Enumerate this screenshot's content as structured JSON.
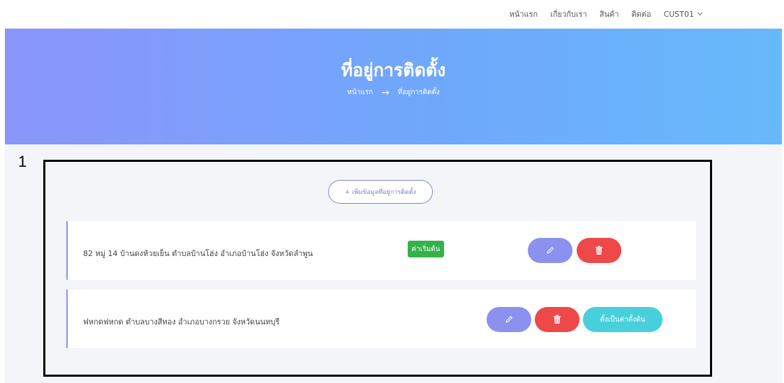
{
  "nav": {
    "items": [
      "หน้าแรก",
      "เกี่ยวกับเรา",
      "สินค้า",
      "ติดต่อ"
    ],
    "user": "CUST01"
  },
  "hero": {
    "title": "ที่อยู่การติดตั้ง",
    "breadcrumb": {
      "home": "หน้าแรก",
      "current": "ที่อยู่การติดตั้ง"
    }
  },
  "annotation": {
    "label": "1"
  },
  "main": {
    "add_button": "+ เพิ่มข้อมูลที่อยู่การติดตั้ง",
    "addresses": [
      {
        "text": "82 หมู่ 14 บ้านดงห้วยเย็น ตำบลบ้านโฮ่ง อำเภอบ้านโฮ่ง จังหวัดลำพูน",
        "badge": "ค่าเริ่มต้น"
      },
      {
        "text": "ฟหกดฟหกด ตำบลบางสีทอง อำเภอบางกรวย จังหวัดนนทบุรี",
        "set_default_label": "ตั้งเป็นค่าตั้งต้น"
      }
    ]
  },
  "icons": {
    "edit": "pencil-icon",
    "delete": "trash-icon",
    "nav_chevron": "chevron-down-icon",
    "breadcrumb_arrow": "arrow-right-icon"
  },
  "colors": {
    "hero_gradient_start": "#8b95fa",
    "hero_gradient_end": "#67b9fb",
    "edit_button": "#8a92ee",
    "delete_button": "#ee4848",
    "default_badge": "#35b149",
    "set_default_button": "#48cfdc",
    "card_accent": "#8c93e6"
  }
}
